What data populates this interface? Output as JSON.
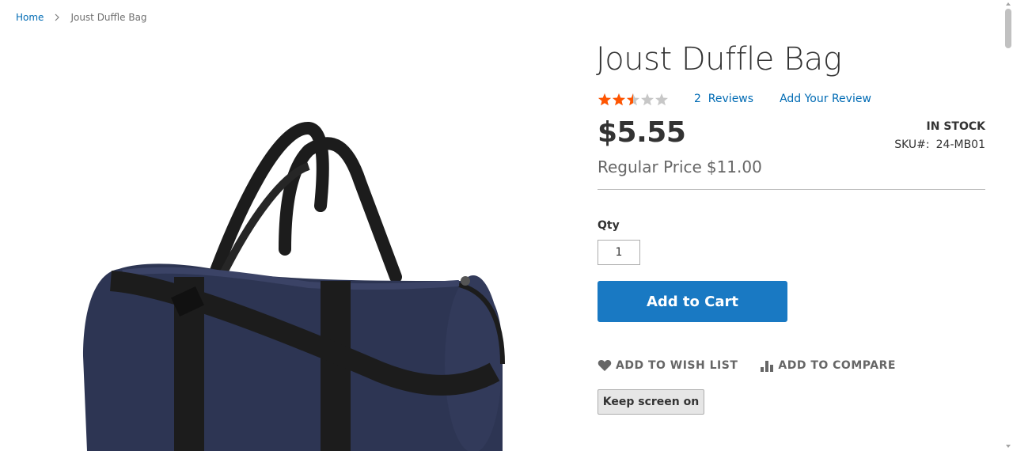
{
  "breadcrumbs": {
    "home": "Home",
    "current": "Joust Duffle Bag"
  },
  "product": {
    "title": "Joust Duffle Bag",
    "rating_percent": 50,
    "rating_stars_max": 5,
    "reviews_link": "2  Reviews",
    "add_review_link": "Add Your Review",
    "price": "$5.55",
    "stock": "IN STOCK",
    "sku_label": "SKU#:",
    "sku_value": "24-MB01",
    "regular_price_label": "Regular Price",
    "regular_price_value": "$11.00",
    "image_alt": "Joust Duffle Bag"
  },
  "purchase": {
    "qty_label": "Qty",
    "qty_value": "1",
    "add_to_cart": "Add to Cart"
  },
  "actions": {
    "wishlist": "ADD TO WISH LIST",
    "compare": "ADD TO COMPARE"
  },
  "keep_screen": "Keep screen on",
  "colors": {
    "link": "#006bb4",
    "primary_button": "#1979c3",
    "star_filled": "#ff5501",
    "star_empty": "#c7c7c7",
    "bag_body": "#2d3553",
    "strap": "#1c1c1c"
  }
}
